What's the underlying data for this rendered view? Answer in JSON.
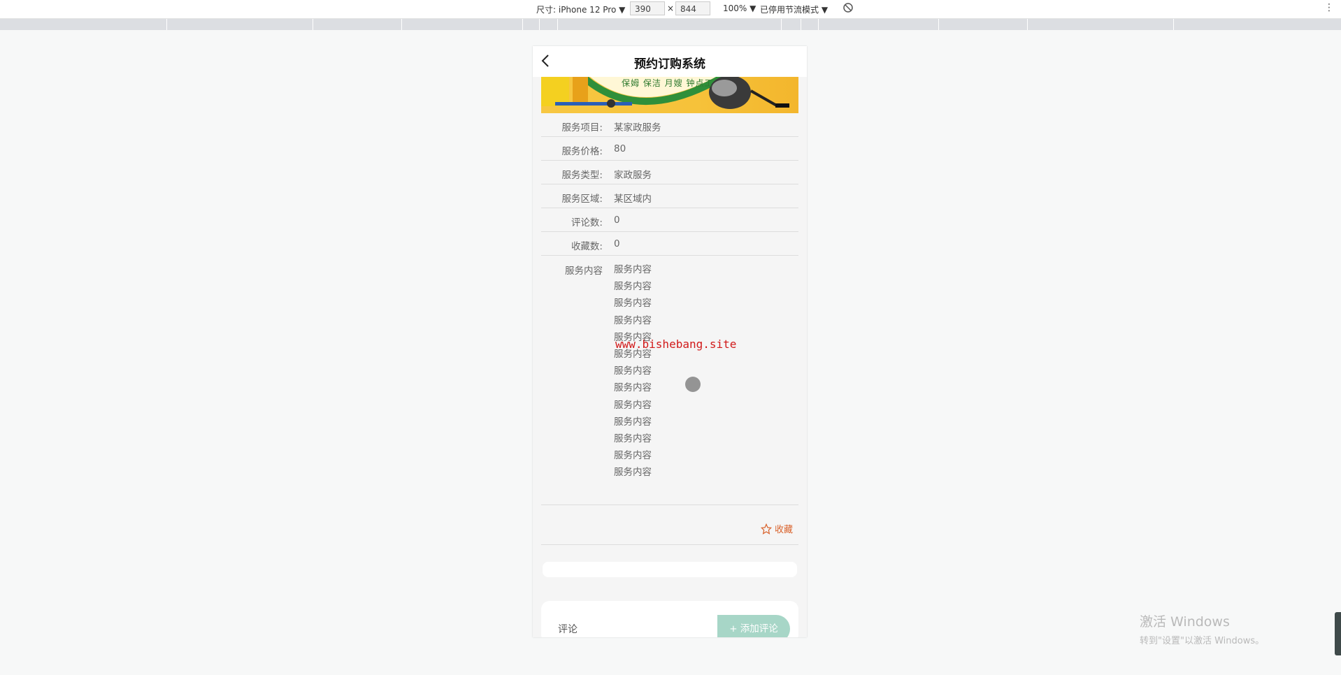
{
  "devtools": {
    "size_label": "尺寸: iPhone 12 Pro ▼",
    "width_value": "390",
    "times": "×",
    "height_value": "844",
    "zoom_label": "100% ▼",
    "throttle_label": "已停用节流模式 ▼",
    "menu": "⋮"
  },
  "app": {
    "title": "预约订购系统",
    "banner_text": "保姆 保洁 月嫂 钟点工",
    "fields": [
      {
        "label": "服务项目:",
        "value": "某家政服务"
      },
      {
        "label": "服务价格:",
        "value": "80"
      },
      {
        "label": "服务类型:",
        "value": "家政服务"
      },
      {
        "label": "服务区域:",
        "value": "某区域内"
      },
      {
        "label": "评论数:",
        "value": "0"
      },
      {
        "label": "收藏数:",
        "value": "0"
      }
    ],
    "content_label": "服务内容",
    "content_lines": [
      "服务内容",
      "服务内容",
      "服务内容",
      "服务内容",
      "服务内容",
      "服务内容",
      "服务内容",
      "服务内容",
      "服务内容",
      "服务内容",
      "服务内容",
      "服务内容",
      "服务内容"
    ],
    "favorite_label": "收藏",
    "comment_label": "评论",
    "add_comment_label": "+ 添加评论"
  },
  "watermark": "www.bishebang.site",
  "windows_activation": {
    "line1": "激活 Windows",
    "line2": "转到\"设置\"以激活 Windows。"
  },
  "colors": {
    "accent_favorite": "#d9622b",
    "add_button": "#a7d6c7",
    "watermark": "#d11a1a"
  }
}
